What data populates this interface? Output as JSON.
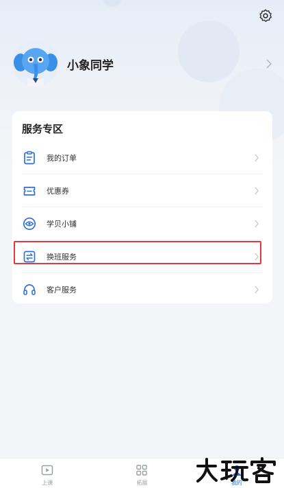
{
  "profile": {
    "name": "小象同学"
  },
  "service": {
    "title": "服务专区",
    "items": [
      {
        "label": "我的订单",
        "icon": "clipboard-icon"
      },
      {
        "label": "优惠券",
        "icon": "coupon-icon"
      },
      {
        "label": "学贝小铺",
        "icon": "eye-shop-icon"
      },
      {
        "label": "换班服务",
        "icon": "swap-icon",
        "highlighted": true
      },
      {
        "label": "客户服务",
        "icon": "headset-icon"
      }
    ]
  },
  "tabs": [
    {
      "label": "上课",
      "icon": "play-icon",
      "active": false
    },
    {
      "label": "拓展",
      "icon": "grid-icon",
      "active": false
    },
    {
      "label": "我的",
      "icon": "person-icon",
      "active": true
    }
  ],
  "watermark": {
    "text": "大玩客"
  },
  "colors": {
    "accent": "#2c6ee3",
    "highlight": "#e0383e",
    "icon": "#2f6fd6"
  }
}
